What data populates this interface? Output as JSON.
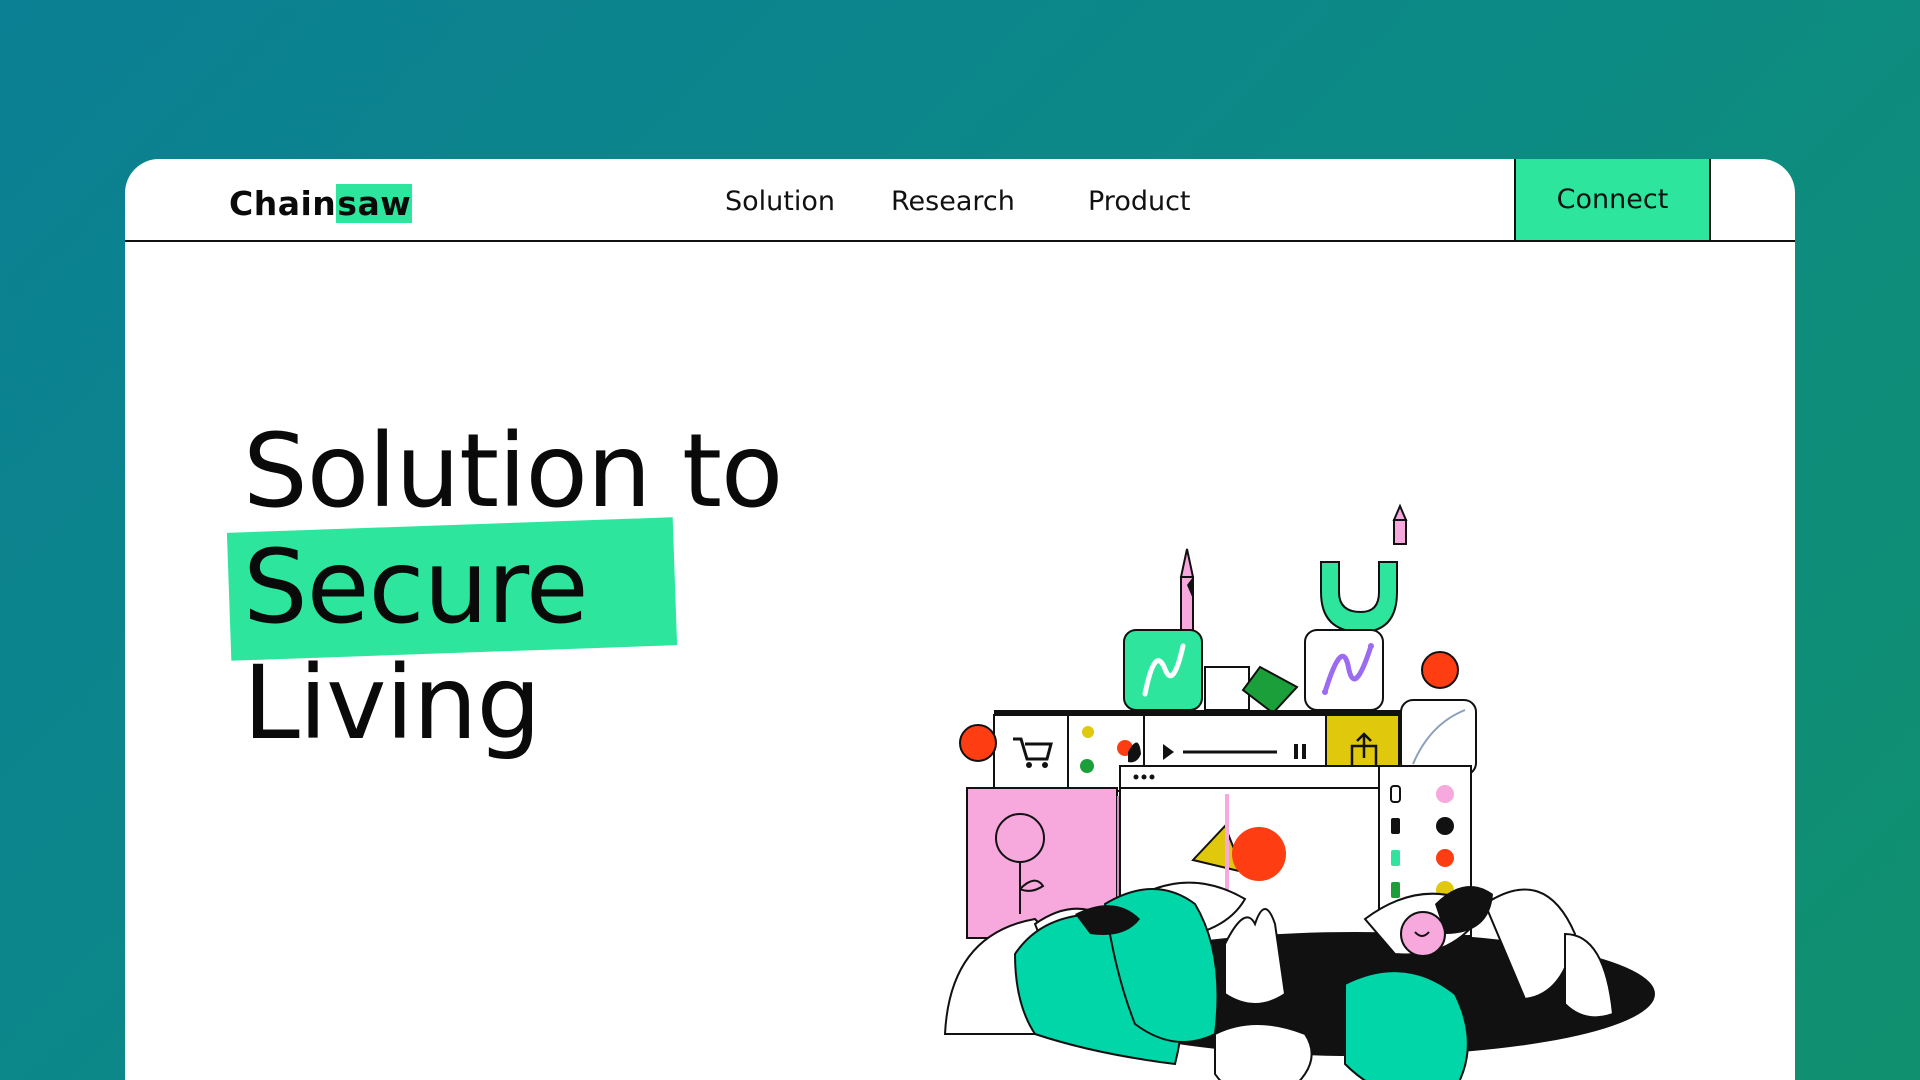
{
  "logo": {
    "prefix": "Chain",
    "highlight": "saw"
  },
  "nav": {
    "items": [
      "Solution",
      "Research",
      "Product"
    ],
    "connect_label": "Connect"
  },
  "hero": {
    "line1": "Solution to",
    "line2": "Secure",
    "line3": "Living"
  },
  "colors": {
    "background_start": "#0b7f93",
    "background_end": "#10906e",
    "accent": "#2ee59d",
    "text": "#0a0a0a",
    "illustration_pink": "#f7a8dc",
    "illustration_red": "#ff3d12",
    "illustration_yellow": "#e0c80c"
  },
  "icons": [
    "cart-icon",
    "play-icon",
    "pause-icon",
    "share-icon",
    "bezier-curve-icon",
    "magnet-icon"
  ]
}
